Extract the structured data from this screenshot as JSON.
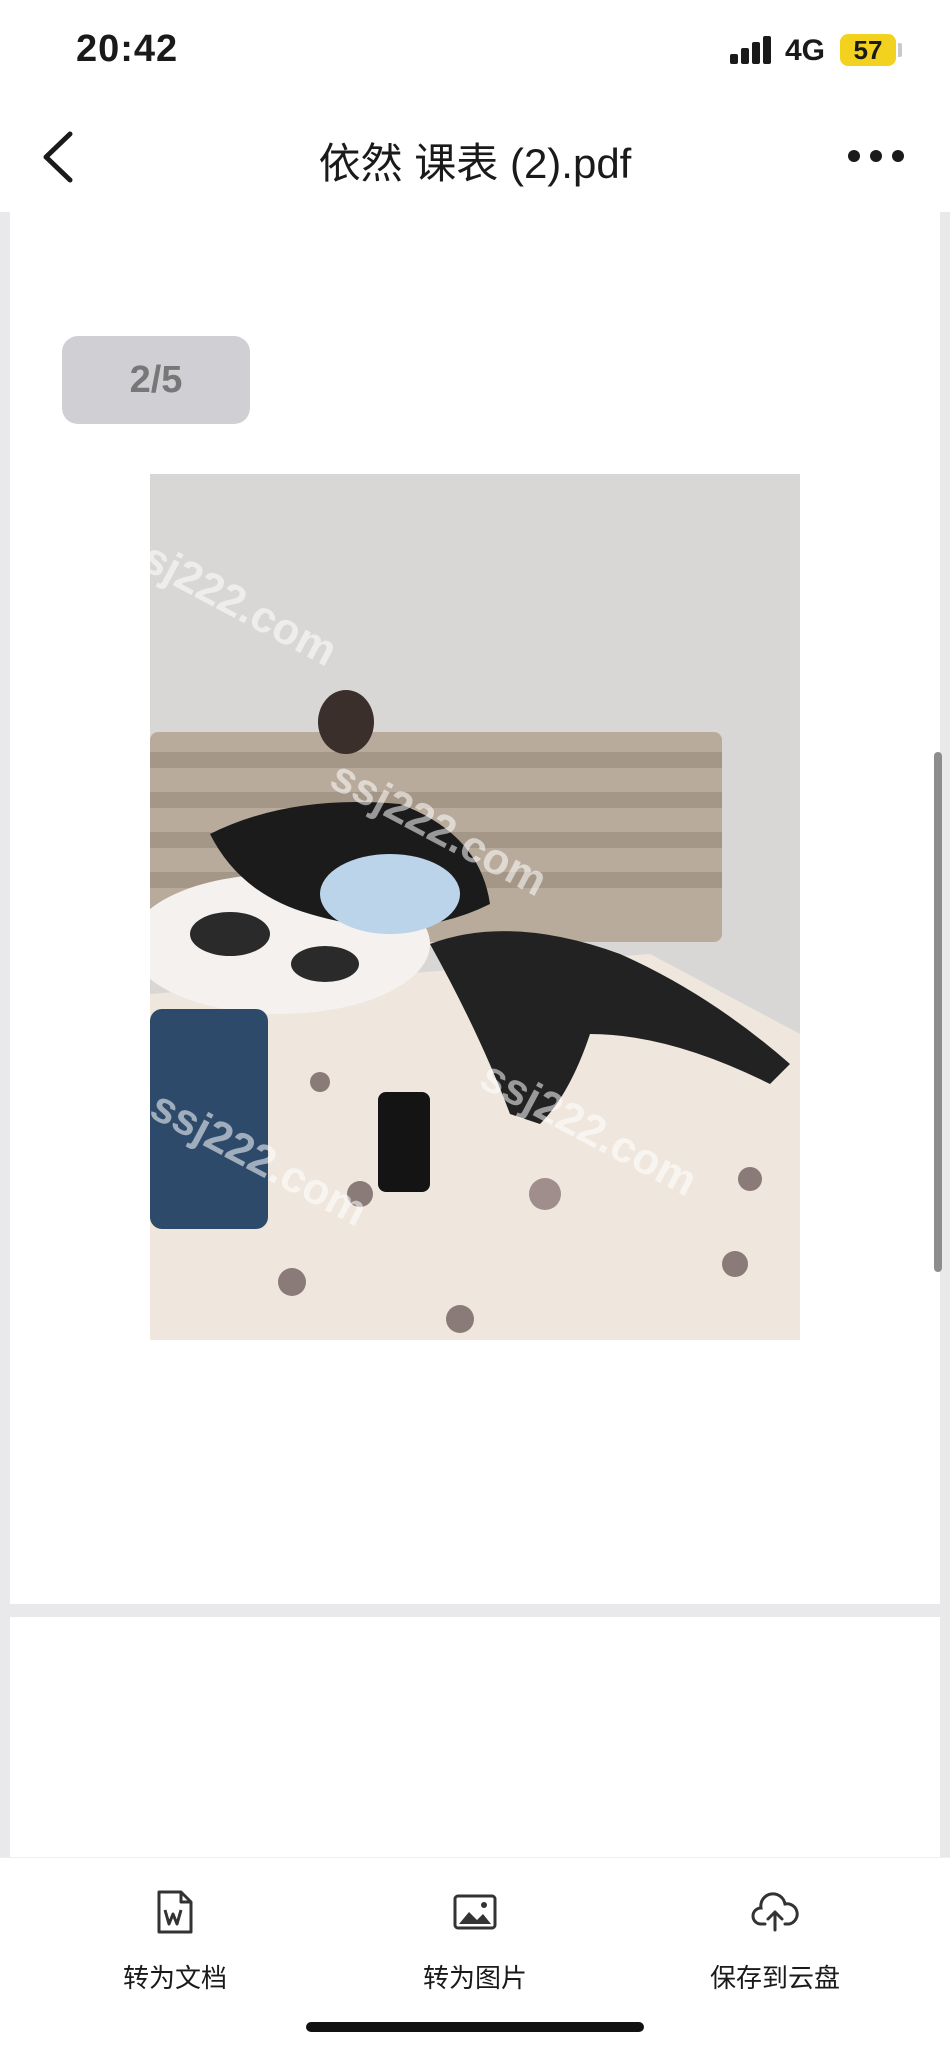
{
  "status_bar": {
    "time": "20:42",
    "network": "4G",
    "battery": "57",
    "icons": [
      "signal-icon",
      "battery-icon"
    ]
  },
  "nav": {
    "title": "依然 课表 (2).pdf",
    "icons": [
      "back-icon",
      "more-icon"
    ]
  },
  "viewer": {
    "page_indicator": "2/5",
    "watermark": "ssj222.com"
  },
  "toolbar": {
    "items": [
      {
        "label": "转为文档",
        "icon": "word-document-icon"
      },
      {
        "label": "转为图片",
        "icon": "image-icon"
      },
      {
        "label": "保存到云盘",
        "icon": "cloud-upload-icon"
      }
    ]
  },
  "colors": {
    "battery": "#f2d21f",
    "viewer_bg": "#e9e9ec",
    "text": "#1a1a1a"
  }
}
